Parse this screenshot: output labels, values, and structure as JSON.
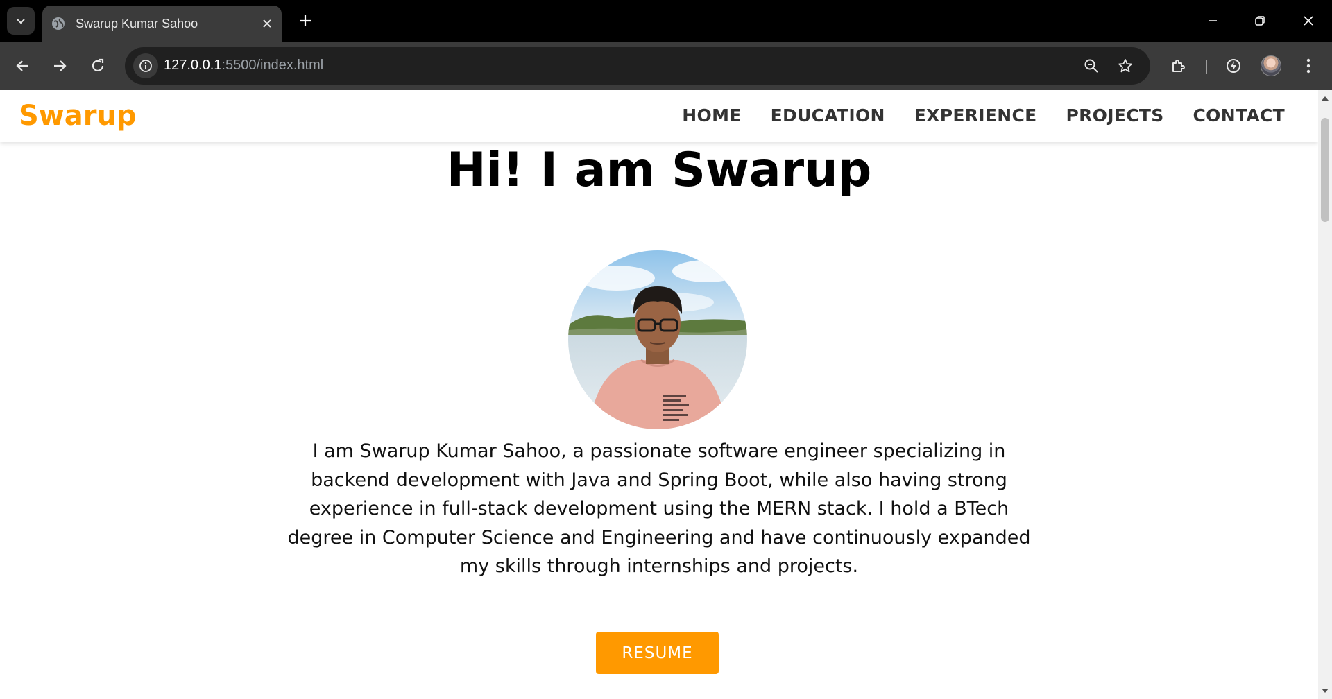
{
  "browser": {
    "tab": {
      "title": "Swarup Kumar Sahoo",
      "favicon": "globe-icon"
    },
    "url_host": "127.0.0.1",
    "url_rest": ":5500/index.html"
  },
  "site": {
    "brand": "Swarup",
    "nav": [
      "HOME",
      "EDUCATION",
      "EXPERIENCE",
      "PROJECTS",
      "CONTACT"
    ],
    "hero_title": "Hi! I am Swarup",
    "intro": "I am Swarup Kumar Sahoo, a passionate software engineer specializing in backend development with Java and Spring Boot, while also having strong experience in full-stack development using the MERN stack. I hold a BTech degree in Computer Science and Engineering and have continuously expanded my skills through internships and projects.",
    "resume_label": "RESUME"
  },
  "colors": {
    "accent": "#ff9900",
    "browser_dark": "#000000",
    "toolbar": "#3b3b3b"
  }
}
